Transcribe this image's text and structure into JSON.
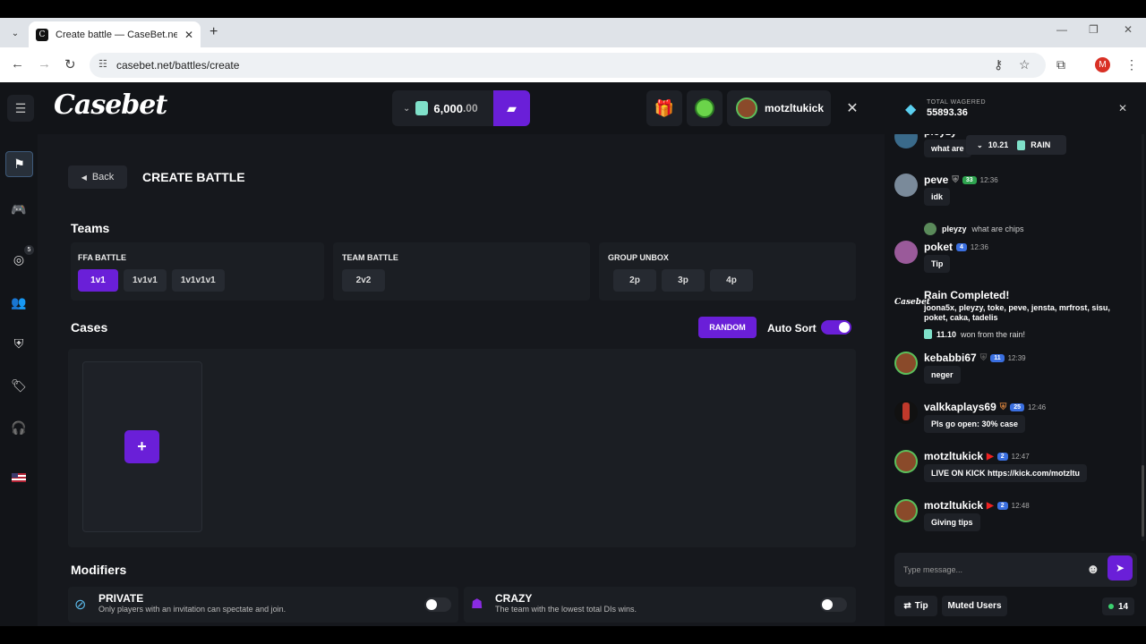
{
  "browser": {
    "tab_title": "Create battle — CaseBet.net",
    "favicon_letter": "C",
    "url": "casebet.net/battles/create",
    "profile_initial": "M"
  },
  "header": {
    "logo": "Casebet",
    "balance_main": "6,000",
    "balance_dec": ".00",
    "username": "motzltukick"
  },
  "page": {
    "back_label": "Back",
    "title": "CREATE BATTLE",
    "teams_title": "Teams",
    "ffa": {
      "label": "FFA BATTLE",
      "options": [
        "1v1",
        "1v1v1",
        "1v1v1v1"
      ],
      "selected": 0
    },
    "team": {
      "label": "TEAM BATTLE",
      "options": [
        "2v2"
      ]
    },
    "group": {
      "label": "GROUP UNBOX",
      "options": [
        "2p",
        "3p",
        "4p"
      ]
    },
    "cases_title": "Cases",
    "random_label": "RANDOM",
    "autosort_label": "Auto Sort",
    "autosort_on": true,
    "add_case_symbol": "+",
    "modifiers_title": "Modifiers",
    "modifiers": [
      {
        "title": "PRIVATE",
        "desc": "Only players with an invitation can spectate and join.",
        "on": false
      },
      {
        "title": "CRAZY",
        "desc": "The team with the lowest total DIs wins.",
        "on": false
      }
    ]
  },
  "sidebar": {
    "badge_count": "5"
  },
  "chat": {
    "wagered_label": "TOTAL WAGERED",
    "wagered_value": "55893.36",
    "partial_name": "pleyzy",
    "partial_text": "what are",
    "rain_pill_amount": "10.21",
    "rain_pill_label": "RAIN",
    "messages": [
      {
        "name": "peve",
        "level": "33",
        "time": "12:36",
        "text": "idk"
      },
      {
        "reply_to": "pleyzy",
        "reply_text": "what are chips",
        "name": "poket",
        "level": "4",
        "time": "12:36",
        "text": "Tip"
      },
      {
        "name": "kebabbi67",
        "level": "11",
        "time": "12:39",
        "text": "neger"
      },
      {
        "name": "valkkaplays69",
        "level": "25",
        "time": "12:46",
        "text": "Pls go open: 30% case"
      },
      {
        "name": "motzltukick",
        "level": "2",
        "time": "12:47",
        "text": "LIVE ON KICK https://kick.com/motzltu"
      },
      {
        "name": "motzltukick",
        "level": "2",
        "time": "12:48",
        "text": "Giving tips"
      }
    ],
    "rain": {
      "title": "Rain Completed!",
      "users": "joona5x, pleyzy, toke, peve, jensta, mrfrost, sisu, poket, caka, tadelis",
      "amount": "11.10",
      "suffix": "won from the rain!"
    },
    "input_placeholder": "Type message...",
    "tip_label": "Tip",
    "muted_label": "Muted Users",
    "online_count": "14"
  },
  "colors": {
    "accent": "#6a1fd8",
    "bg": "#16181d",
    "panel": "#1b1e23"
  }
}
